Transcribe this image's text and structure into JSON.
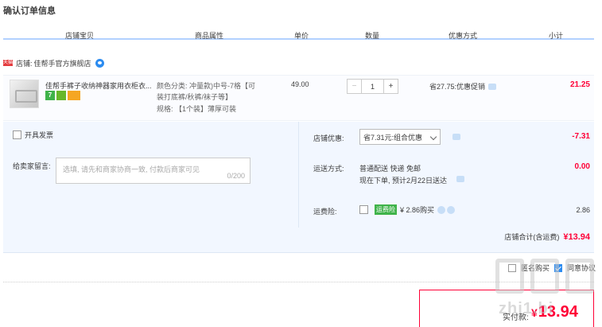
{
  "page": {
    "title": "确认订单信息"
  },
  "columns": [
    "店铺宝贝",
    "商品属性",
    "单价",
    "数量",
    "优惠方式",
    "小计"
  ],
  "shop": {
    "badge": "天猫",
    "label": "店铺:",
    "name": "佳帮手官方旗舰店"
  },
  "item": {
    "title": "佳帮手裤子收纳神器家用衣柜衣...",
    "badges": [
      "7",
      "",
      ""
    ],
    "attr_line1": "颜色分类: 冲量款)中号-7格【可",
    "attr_line2": "装打底裤/秋裤/袜子等】",
    "attr_line3": "规格: 【1个装】薄厚可装",
    "price": "49.00",
    "qty": {
      "minus": "−",
      "value": "1",
      "plus": "+"
    },
    "promo": "省27.75:优惠促销",
    "subtotal": "21.25"
  },
  "invoice": {
    "label": "开具发票"
  },
  "message": {
    "label": "给卖家留言:",
    "placeholder": "选填, 请先和商家协商一致, 付款后商家可见",
    "count": "0/200"
  },
  "shop_discount": {
    "label": "店铺优惠:",
    "selected": "省7.31元:组合优惠",
    "value": "-7.31"
  },
  "shipping": {
    "label": "运送方式:",
    "line1": "普通配送 快递 免邮",
    "line2": "现在下单, 预计2月22日送达",
    "value": "0.00"
  },
  "insurance": {
    "label": "运费险:",
    "tag": "运费险",
    "price": "¥ 2.86购买",
    "value": "2.86"
  },
  "shop_total": {
    "label": "店铺合计(含运费)",
    "value": "¥13.94"
  },
  "bottom_options": {
    "option1": "匿名购买",
    "option2": "同意协议"
  },
  "payment": {
    "label": "实付款:",
    "currency": "¥",
    "amount": "13.94"
  },
  "watermark": {
    "text": "zhi1.bi"
  },
  "colors": {
    "accent": "#ff0036",
    "brand_blue": "#2d8cf0",
    "panel_bg": "#f2f7ff"
  }
}
